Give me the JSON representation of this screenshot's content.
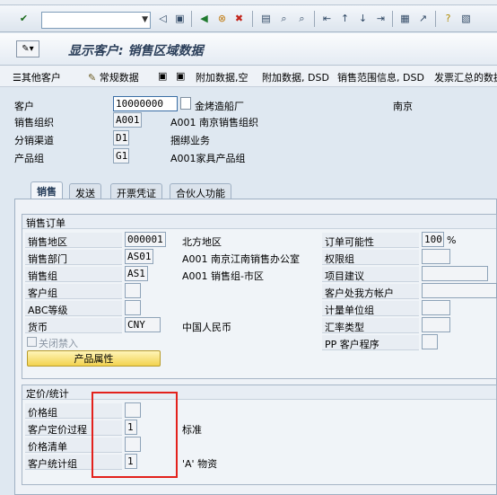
{
  "toolbar": {
    "icons": [
      "check-icon",
      "back-icon",
      "save-icon",
      "nav-back-icon",
      "exit-icon",
      "cancel-icon",
      "print-icon",
      "find-icon",
      "find-next-icon",
      "first-page-icon",
      "prev-page-icon",
      "next-page-icon",
      "last-page-icon",
      "new-session-icon",
      "shortcut-icon",
      "help-icon",
      "layout-icon"
    ]
  },
  "title": "显示客户: 销售区域数据",
  "app_toolbar": {
    "other_customer": "其他客户",
    "general_data": "常规数据",
    "additional_data": "附加数据,空",
    "additional_data_dsd": "附加数据, DSD",
    "sales_area_info_dsd": "销售范围信息, DSD",
    "invoice_summary": "发票汇总的数据"
  },
  "header": {
    "customer_label": "客户",
    "customer_value": "10000000",
    "customer_name": "金烤造船厂",
    "customer_city": "南京",
    "sales_org_label": "销售组织",
    "sales_org_value": "A001",
    "sales_org_desc": "A001 南京销售组织",
    "channel_label": "分销渠道",
    "channel_value": "D1",
    "channel_desc": "捆绑业务",
    "product_group_label": "产品组",
    "product_group_value": "G1",
    "product_group_desc": "A001家具产品组"
  },
  "tabs": [
    "销售",
    "发送",
    "开票凭证",
    "合伙人功能"
  ],
  "sales_order": {
    "title": "销售订单",
    "district_label": "销售地区",
    "district_value": "000001",
    "district_desc": "北方地区",
    "office_label": "销售部门",
    "office_value": "AS01",
    "office_desc": "A001 南京江南销售办公室",
    "group_label": "销售组",
    "group_value": "AS1",
    "group_desc": "A001 销售组-市区",
    "customer_group_label": "客户组",
    "abc_label": "ABC等级",
    "currency_label": "货币",
    "currency_value": "CNY",
    "currency_desc": "中国人民币",
    "closed_label": "关闭禁入",
    "product_attr_button": "产品属性",
    "order_prob_label": "订单可能性",
    "order_prob_value": "100",
    "order_prob_unit": "%",
    "auth_group_label": "权限组",
    "item_proposal_label": "项目建议",
    "acct_at_cust_label": "客户处我方帐户",
    "unit_group_label": "计量单位组",
    "exch_rate_type_label": "汇率类型",
    "pp_cust_proc_label": "PP 客户程序"
  },
  "pricing": {
    "title": "定价/统计",
    "price_group_label": "价格组",
    "cust_pricing_proc_label": "客户定价过程",
    "cust_pricing_proc_value": "1",
    "cust_pricing_proc_desc": "标准",
    "price_list_label": "价格清单",
    "cust_stats_group_label": "客户统计组",
    "cust_stats_group_value": "1",
    "cust_stats_group_desc": "'A' 物资"
  }
}
